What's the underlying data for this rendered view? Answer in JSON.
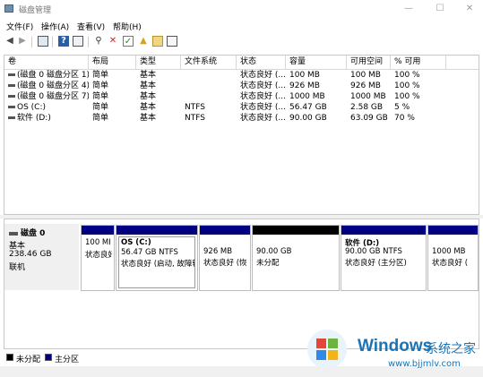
{
  "window": {
    "title": "磁盘管理",
    "minimize": "—",
    "maximize": "☐",
    "close": "✕"
  },
  "menu": [
    "文件(F)",
    "操作(A)",
    "查看(V)",
    "帮助(H)"
  ],
  "toolbar_icons": [
    "back-icon",
    "forward-icon",
    "console-tree-icon",
    "help-icon",
    "properties-icon",
    "connect-icon",
    "delete-icon",
    "check-icon",
    "import-icon",
    "export-icon",
    "list-icon"
  ],
  "volume_table": {
    "columns": [
      "卷",
      "布局",
      "类型",
      "文件系统",
      "状态",
      "容量",
      "可用空间",
      "% 可用"
    ],
    "rows": [
      [
        "(磁盘 0 磁盘分区 1)",
        "简单",
        "基本",
        "",
        "状态良好 (...",
        "100 MB",
        "100 MB",
        "100 %"
      ],
      [
        "(磁盘 0 磁盘分区 4)",
        "简单",
        "基本",
        "",
        "状态良好 (...",
        "926 MB",
        "926 MB",
        "100 %"
      ],
      [
        "(磁盘 0 磁盘分区 7)",
        "简单",
        "基本",
        "",
        "状态良好 (...",
        "1000 MB",
        "1000 MB",
        "100 %"
      ],
      [
        "OS (C:)",
        "简单",
        "基本",
        "NTFS",
        "状态良好 (...",
        "56.47 GB",
        "2.58 GB",
        "5 %"
      ],
      [
        "软件 (D:)",
        "简单",
        "基本",
        "NTFS",
        "状态良好 (...",
        "90.00 GB",
        "63.09 GB",
        "70 %"
      ]
    ]
  },
  "disk": {
    "name": "磁盘 0",
    "type": "基本",
    "size": "238.46 GB",
    "status": "联机",
    "partitions": [
      {
        "name": "",
        "size": "100 MI",
        "status": "状态良好",
        "kind": "primary"
      },
      {
        "name": "OS (C:)",
        "size": "56.47 GB NTFS",
        "status": "状态良好 (启动, 故障转",
        "kind": "primary"
      },
      {
        "name": "",
        "size": "926 MB",
        "status": "状态良好 (恢",
        "kind": "primary"
      },
      {
        "name": "",
        "size": "90.00 GB",
        "status": "未分配",
        "kind": "unallocated"
      },
      {
        "name": "软件 (D:)",
        "size": "90.00 GB NTFS",
        "status": "状态良好 (主分区)",
        "kind": "primary"
      },
      {
        "name": "",
        "size": "1000 MB",
        "status": "状态良好 (",
        "kind": "primary"
      }
    ]
  },
  "legend": [
    {
      "label": "未分配",
      "color": "#000000"
    },
    {
      "label": "主分区",
      "color": "#000080"
    }
  ],
  "watermark": {
    "brand": "Windows",
    "site_name": "系统之家",
    "url": "www.bjjmlv.com"
  }
}
